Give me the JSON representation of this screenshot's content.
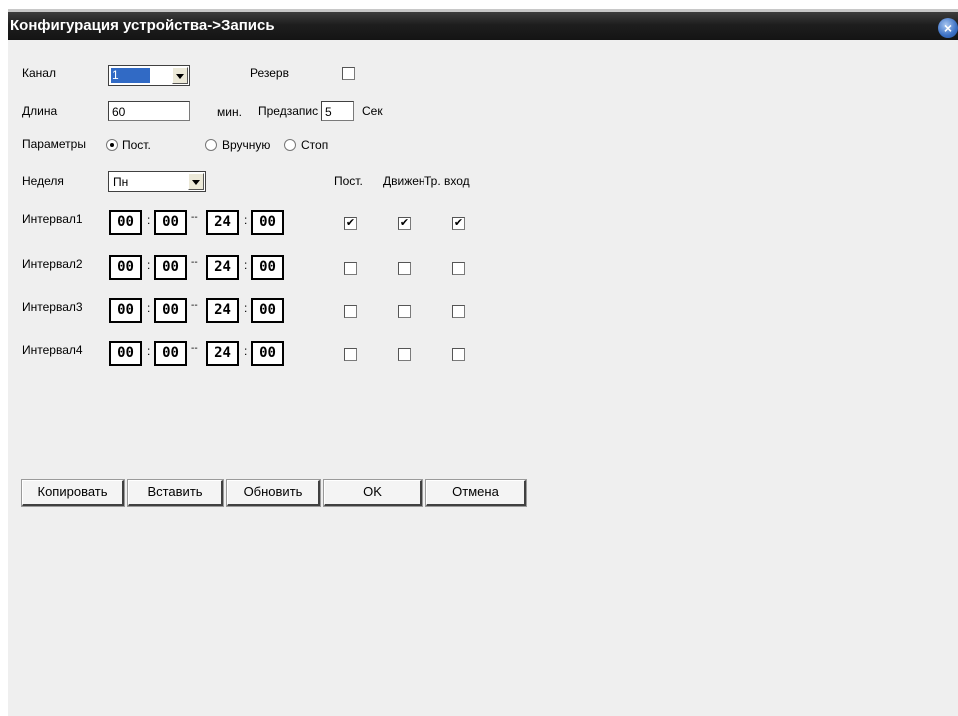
{
  "window": {
    "title": "Конфигурация устройства->Запись",
    "close_glyph": "×"
  },
  "form": {
    "channel": {
      "label": "Канал",
      "value": "1"
    },
    "reserve": {
      "label": "Резерв",
      "checked": false
    },
    "length": {
      "label": "Длина",
      "value": "60",
      "unit": "мин."
    },
    "prerecord": {
      "label": "Предзапис",
      "value": "5",
      "unit": "Сек"
    },
    "parameter": {
      "label": "Параметры",
      "options": [
        {
          "label": "Пост.",
          "selected": true
        },
        {
          "label": "Вручную",
          "selected": false
        },
        {
          "label": "Стоп",
          "selected": false
        }
      ]
    },
    "week": {
      "label": "Неделя",
      "value": "Пн"
    },
    "columns": {
      "const": "Пост.",
      "motion": "Движен",
      "alarm": "Тр. вход"
    }
  },
  "intervals": [
    {
      "label": "Интервал1",
      "start_h": "00",
      "start_m": "00",
      "end_h": "24",
      "end_m": "00",
      "const": true,
      "motion": true,
      "alarm": true
    },
    {
      "label": "Интервал2",
      "start_h": "00",
      "start_m": "00",
      "end_h": "24",
      "end_m": "00",
      "const": false,
      "motion": false,
      "alarm": false
    },
    {
      "label": "Интервал3",
      "start_h": "00",
      "start_m": "00",
      "end_h": "24",
      "end_m": "00",
      "const": false,
      "motion": false,
      "alarm": false
    },
    {
      "label": "Интервал4",
      "start_h": "00",
      "start_m": "00",
      "end_h": "24",
      "end_m": "00",
      "const": false,
      "motion": false,
      "alarm": false
    }
  ],
  "buttons": {
    "copy": "Копировать",
    "paste": "Вставить",
    "refresh": "Обновить",
    "ok": "OK",
    "cancel": "Отмена"
  },
  "check_glyph": "✔",
  "time_separator": ":",
  "range_separator": "--"
}
